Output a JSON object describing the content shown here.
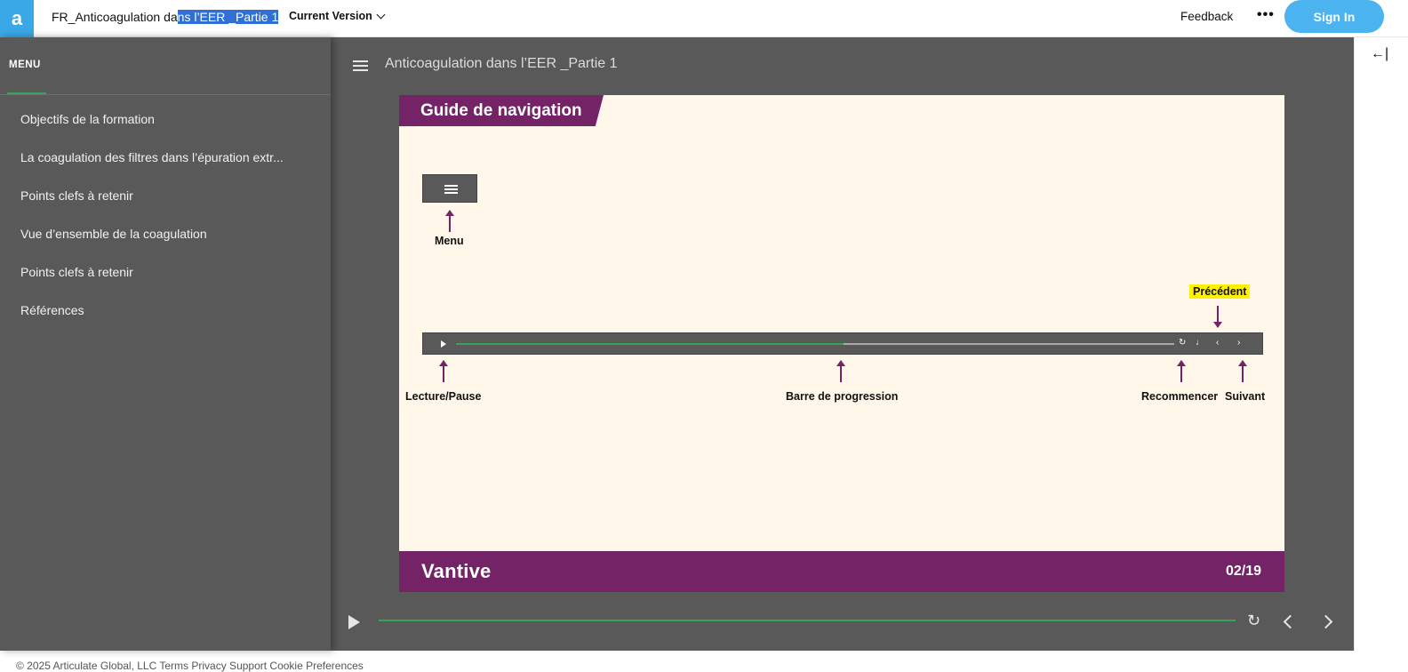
{
  "app": {
    "logo_glyph": "a",
    "accent": "#3aa7e6"
  },
  "header": {
    "title_prefix": "FR_Anticoagulation da",
    "title_selected": "ns l’EER _Partie 1",
    "version_label": "Current Version",
    "feedback_label": "Feedback",
    "more_label": "•••",
    "signin_label": "Sign In"
  },
  "sidebar": {
    "heading": "MENU",
    "items": [
      {
        "label": "Objectifs de la formation"
      },
      {
        "label": "La coagulation des filtres dans l’épuration extr..."
      },
      {
        "label": "Points clefs à retenir"
      },
      {
        "label": "Vue d’ensemble de la coagulation"
      },
      {
        "label": "Points clefs à retenir"
      },
      {
        "label": "Références"
      }
    ]
  },
  "player": {
    "title": "Anticoagulation dans l’EER _Partie 1",
    "progress_fraction": 1.0,
    "icons": [
      "play-icon",
      "replay-icon",
      "chevron-left-icon",
      "chevron-right-icon"
    ]
  },
  "slide": {
    "banner": "Guide de navigation",
    "labels": {
      "menu": "Menu",
      "previous": "Précédent",
      "play_pause": "Lecture/Pause",
      "progress_bar": "Barre de progression",
      "restart": "Recommencer",
      "next": "Suivant"
    },
    "mini_progress_fraction": 0.54,
    "brand": "Vantive",
    "page_indicator": "02/19",
    "colors": {
      "purple": "#742367",
      "cream": "#fff8ea",
      "highlight": "#fff200"
    }
  },
  "right_strip": {
    "collapse_glyph": "←|"
  },
  "footer": {
    "text": "© 2025 Articulate Global, LLC   Terms   Privacy   Support   Cookie Preferences"
  }
}
